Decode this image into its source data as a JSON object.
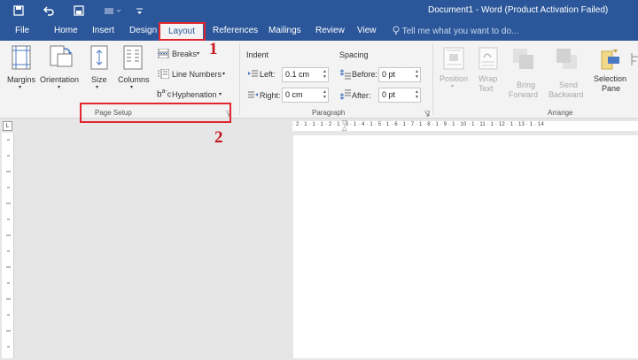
{
  "window": {
    "title": "Document1 - Word (Product Activation Failed)"
  },
  "tabs": {
    "file": "File",
    "home": "Home",
    "insert": "Insert",
    "design": "Design",
    "layout": "Layout",
    "references": "References",
    "mailings": "Mailings",
    "review": "Review",
    "view": "View",
    "tellme": "Tell me what you want to do..."
  },
  "page_setup": {
    "margins": "Margins",
    "orientation": "Orientation",
    "size": "Size",
    "columns": "Columns",
    "breaks": "Breaks",
    "line_numbers": "Line Numbers",
    "hyphenation": "Hyphenation",
    "group_label": "Page Setup"
  },
  "paragraph": {
    "indent_title": "Indent",
    "spacing_title": "Spacing",
    "left_label": "Left:",
    "left_value": "0.1 cm",
    "right_label": "Right:",
    "right_value": "0 cm",
    "before_label": "Before:",
    "before_value": "0 pt",
    "after_label": "After:",
    "after_value": "0 pt",
    "group_label": "Paragraph"
  },
  "arrange": {
    "position": "Position",
    "wrap_text_1": "Wrap",
    "wrap_text_2": "Text",
    "bring_forward_1": "Bring",
    "bring_forward_2": "Forward",
    "send_backward_1": "Send",
    "send_backward_2": "Backward",
    "selection_pane_1": "Selection",
    "selection_pane_2": "Pane",
    "group_label": "Arrange"
  },
  "ruler": {
    "horizontal": "· 2 · 1 · 1 · 1 · 2 · 1 · 3 · 1 · 4 · 1 · 5 · 1 · 6 · 1 · 7 · 1 · 8 · 1 · 9 · 1 · 10 · 1 · 11 · 1 · 12 · 1 · 13 · 1 · 14",
    "tab_corner": "L"
  },
  "annotations": {
    "step1": "1",
    "step2": "2"
  },
  "colors": {
    "accent": "#2b579a",
    "highlight": "#e0262f",
    "annotation": "#c4161c"
  }
}
